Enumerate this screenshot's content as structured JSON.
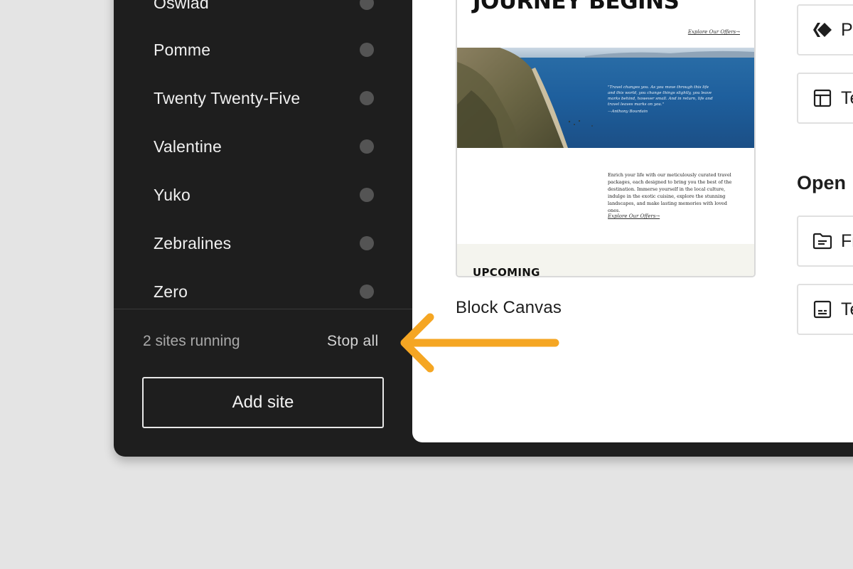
{
  "sidebar": {
    "sites": [
      {
        "name": "Oswlad"
      },
      {
        "name": "Pomme"
      },
      {
        "name": "Twenty Twenty-Five"
      },
      {
        "name": "Valentine"
      },
      {
        "name": "Yuko"
      },
      {
        "name": "Zebralines"
      },
      {
        "name": "Zero"
      }
    ],
    "running_status": "2 sites running",
    "stop_all_label": "Stop all",
    "add_site_label": "Add site"
  },
  "preview": {
    "headline": "JOURNEY BEGINS",
    "hero_link": "Explore Our Offers→",
    "quote": "\"Travel changes you. As you move through this life and this world, you change things slightly, you leave marks behind, however small. And in return, life and travel leaves marks on you.\"",
    "quote_author": "—Anthony Bourdain",
    "description": "Enrich your life with our meticulously curated travel packages, each designed to bring you the best of the destination. Immerse yourself in the local culture, indulge in the exotic cuisine, explore the stunning landscapes, and make lasting memories with loved ones.",
    "description_link": "Explore Our Offers→",
    "upcoming_label": "UPCOMING"
  },
  "site_title": "Block Canvas",
  "actions": {
    "top": [
      {
        "label": "Pa",
        "icon": "diamond-icon"
      },
      {
        "label": "Te",
        "icon": "layout-template-icon"
      }
    ],
    "open_heading": "Open",
    "open": [
      {
        "label": "Fi",
        "icon": "folder-icon"
      },
      {
        "label": "Te",
        "icon": "terminal-icon"
      }
    ]
  },
  "colors": {
    "sidebar_bg": "#1e1e1e",
    "main_bg": "#ffffff",
    "status_dot": "#545454",
    "arrow": "#f5a623",
    "page_bg": "#e4e4e4"
  }
}
